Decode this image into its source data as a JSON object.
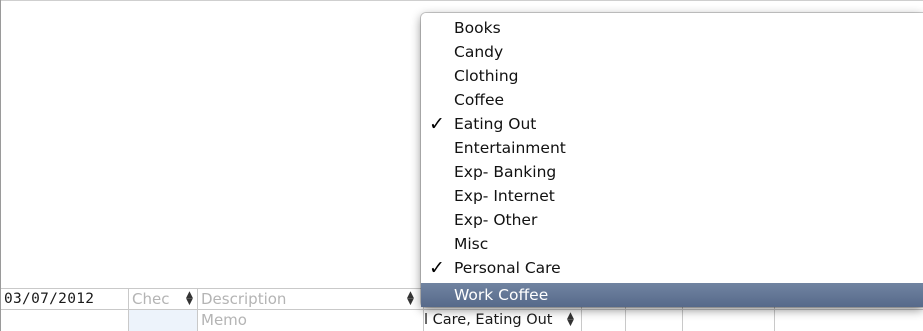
{
  "register": {
    "entry_row": {
      "date": "03/07/2012",
      "check_placeholder": "Chec",
      "description_placeholder": "Description"
    },
    "memo_row": {
      "memo_placeholder": "Memo",
      "category_value": "l Care, Eating Out"
    }
  },
  "category_menu": {
    "items": [
      {
        "label": "Books",
        "checked": false
      },
      {
        "label": "Candy",
        "checked": false
      },
      {
        "label": "Clothing",
        "checked": false
      },
      {
        "label": "Coffee",
        "checked": false
      },
      {
        "label": "Eating Out",
        "checked": true
      },
      {
        "label": "Entertainment",
        "checked": false
      },
      {
        "label": "Exp- Banking",
        "checked": false
      },
      {
        "label": "Exp- Internet",
        "checked": false
      },
      {
        "label": "Exp- Other",
        "checked": false
      },
      {
        "label": "Misc",
        "checked": false
      },
      {
        "label": "Personal Care",
        "checked": true
      },
      {
        "label": "Work Coffee",
        "checked": false,
        "highlighted": true
      }
    ],
    "check_glyph": "✓",
    "highlight_color": "#5d7091"
  },
  "icons": {
    "stepper": "up-down-arrows-icon",
    "checkmark": "checkmark-icon"
  }
}
